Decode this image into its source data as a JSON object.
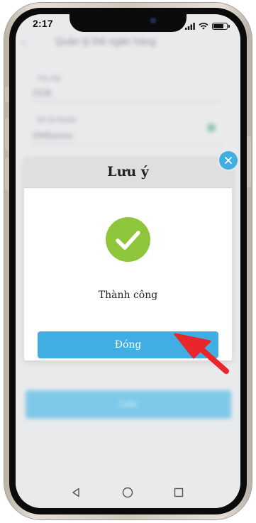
{
  "status_bar": {
    "time": "2:17",
    "battery_level": 0.85
  },
  "background_screen": {
    "title": "Quản lý thẻ ngân hàng",
    "fields": [
      {
        "label": "Tên thẻ",
        "value": "OCB"
      },
      {
        "label": "Số tài khoản",
        "value": "0345xxxxx"
      }
    ],
    "submit_label": "Lưu"
  },
  "dialog": {
    "title": "Lưu ý",
    "message": "Thành công",
    "button_label": "Đóng",
    "status": "success"
  },
  "colors": {
    "accent": "#40aee2",
    "success": "#8ec53b",
    "annotation_arrow": "#e8262b"
  },
  "icons": [
    "wifi-icon",
    "signal-icon",
    "battery-icon",
    "checkmark-icon",
    "close-icon",
    "back-icon",
    "home-icon",
    "recents-icon",
    "annotation-arrow-icon"
  ]
}
